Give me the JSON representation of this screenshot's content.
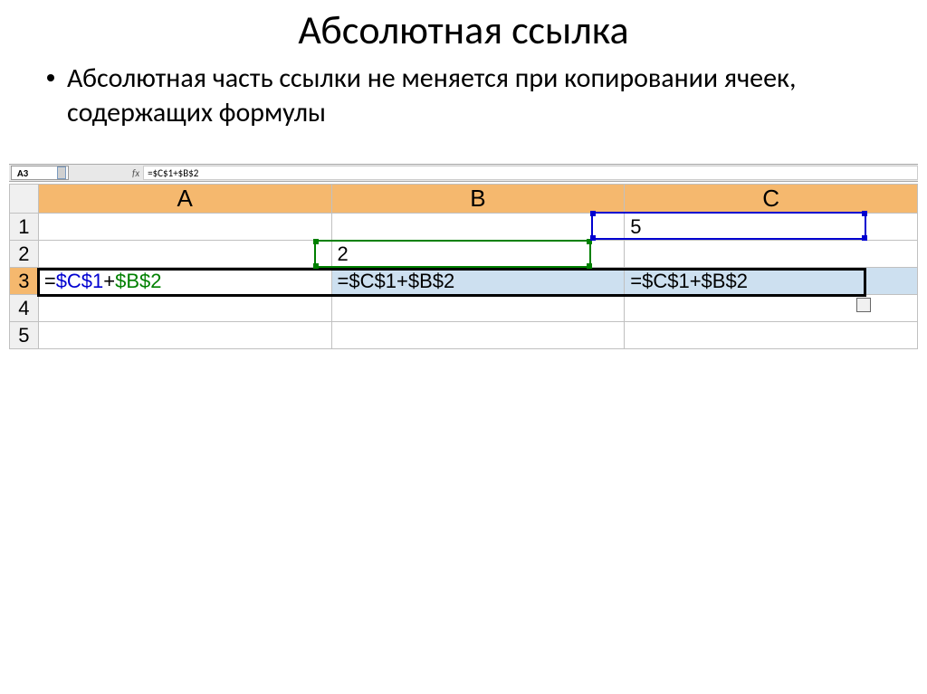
{
  "title": "Абсолютная ссылка",
  "bullet_text": "Абсолютная часть ссылки не меняется при копировании ячеек, содержащих формулы",
  "formula_bar": {
    "name_box": "A3",
    "fx_label": "fx",
    "formula": "=$C$1+$B$2"
  },
  "columns": [
    "A",
    "B",
    "C"
  ],
  "rows": {
    "r1": {
      "num": "1",
      "A": "",
      "B": "",
      "C": "5"
    },
    "r2": {
      "num": "2",
      "A": "",
      "B": "2",
      "C": ""
    },
    "r3": {
      "num": "3",
      "A": "=$C$1+$B$2",
      "B": "=$C$1+$B$2",
      "C": "=$C$1+$B$2"
    },
    "r4": {
      "num": "4",
      "A": "",
      "B": "",
      "C": ""
    },
    "r5": {
      "num": "5",
      "A": "",
      "B": "",
      "C": ""
    }
  },
  "formula_parts": {
    "eq": "=",
    "ref1": "$C$1",
    "plus": "+",
    "ref2": "$B$2"
  }
}
